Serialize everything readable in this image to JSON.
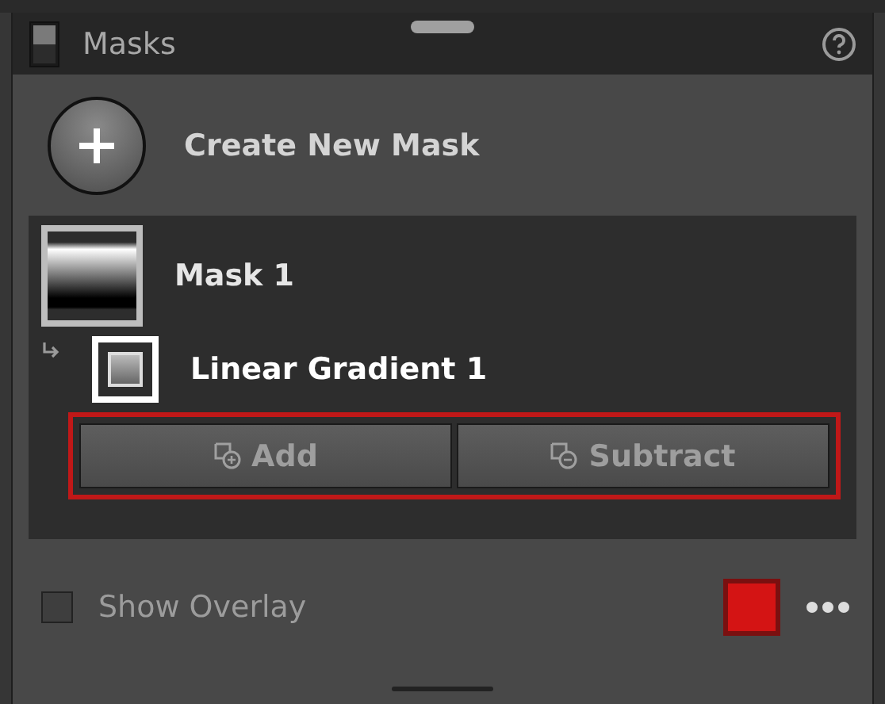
{
  "panel": {
    "title": "Masks"
  },
  "create_button": {
    "label": "Create New Mask"
  },
  "masks": [
    {
      "name": "Mask 1",
      "selected": false,
      "children": [
        {
          "name": "Linear Gradient 1",
          "selected": true
        }
      ]
    }
  ],
  "component_actions": {
    "highlighted": true,
    "buttons": [
      {
        "label": "Add",
        "kind": "add"
      },
      {
        "label": "Subtract",
        "kind": "subtract"
      }
    ]
  },
  "overlay": {
    "label": "Show Overlay",
    "checked": false,
    "color": "#d41414"
  }
}
